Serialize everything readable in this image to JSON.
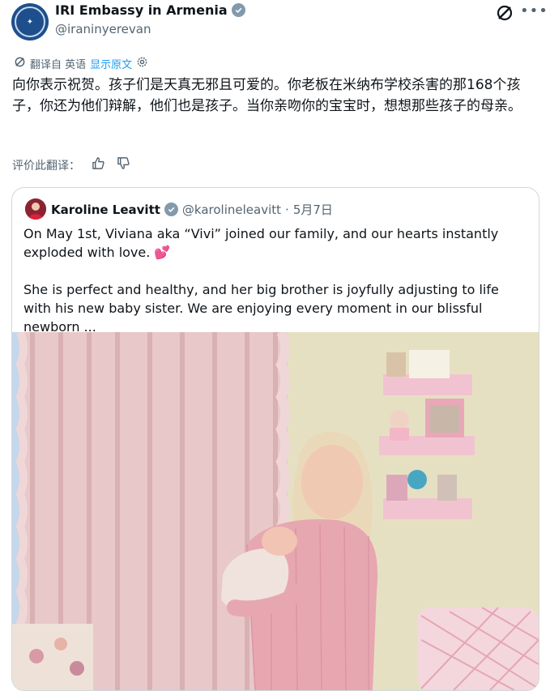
{
  "account": {
    "name": "IRI Embassy in Armenia",
    "handle": "@iraninyerevan"
  },
  "translation": {
    "translated_from": "翻译自 英语",
    "show_original": "显示原文"
  },
  "tweet": {
    "text": "向你表示祝贺。孩子们是天真无邪且可爱的。你老板在米纳布学校杀害的那168个孩子，你还为他们辩解，他们也是孩子。当你亲吻你的宝宝时，想想那些孩子的母亲。"
  },
  "rating": {
    "label": "评价此翻译："
  },
  "quoted": {
    "name": "Karoline Leavitt",
    "handle": "@karolineleavitt",
    "separator": "·",
    "date": "5月7日",
    "paragraph1": "On May 1st, Viviana aka “Vivi” joined our family, and our hearts instantly exploded with love. 💕",
    "paragraph2": "She is perfect and healthy, and her big brother is joyfully adjusting to life with his new baby sister. We are enjoying every moment in our blissful newborn ..."
  },
  "colors": {
    "accent": "#1d9bf0",
    "secondary_text": "#536471",
    "border": "#cfd9de",
    "verified_badge": "#829aab"
  },
  "icons": [
    "verified-badge-icon",
    "grok-icon",
    "more-icon",
    "translate-icon",
    "settings-icon",
    "thumbs-up-icon",
    "thumbs-down-icon"
  ]
}
